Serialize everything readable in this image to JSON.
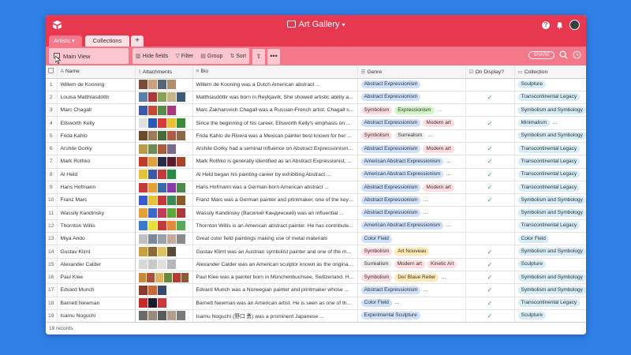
{
  "app": {
    "title": "Art Gallery",
    "accent_color": "#e8384f"
  },
  "tabs": {
    "artists": "Artists",
    "collections": "Collections",
    "add": "+"
  },
  "toolbar": {
    "view_label": "Main View",
    "hide_fields": "Hide fields",
    "filter": "Filter",
    "group": "Group",
    "sort": "Sort",
    "share": "SHARE",
    "more": "•••"
  },
  "columns": {
    "name": "Name",
    "attachments": "Attachments",
    "bio": "Bio",
    "genre": "Genre",
    "on_display": "On Display?",
    "collection": "Collection"
  },
  "rows": [
    {
      "num": "1",
      "name": "Willem de Kooning",
      "bio": "Willem de Kooning was a Dutch American abstract ...",
      "genre": [
        [
          "Abstract Expressionism",
          "blue"
        ]
      ],
      "display": false,
      "collection": [
        [
          "Sculpture",
          "teal"
        ]
      ],
      "thumbs": [
        "#7a4a3a",
        "#c9a07a",
        "#556677",
        "#b08f6f"
      ]
    },
    {
      "num": "2",
      "name": "Louisa Matthíasdóttir",
      "bio": "Matthíasdóttir was born in Reykjavík. She showed artistic ability a...",
      "genre": [
        [
          "Abstract Expressionism",
          "blue"
        ]
      ],
      "display": true,
      "collection": [
        [
          "Transcontinental Legacy",
          "teal"
        ]
      ],
      "thumbs": [
        "#5b7fa8",
        "#aa3a3a",
        "#8aa05a",
        "#c7b48a",
        "#3d5c7a"
      ]
    },
    {
      "num": "3",
      "name": "Marc Chagall",
      "bio": "Marc Zakharovich Chagall was a Russian-French artist. Chagall s...",
      "genre": [
        [
          "Symbolism",
          "red"
        ],
        [
          "Expressionism",
          "green"
        ],
        [
          "Fauvism",
          "cyan"
        ]
      ],
      "display": false,
      "collection": [
        [
          "Symbolism and Symbology",
          "teal"
        ]
      ],
      "thumbs": [
        "#3a5aa8",
        "#c44a3a",
        "#5a8a4a",
        "#a83a7a"
      ]
    },
    {
      "num": "4",
      "name": "Ellsworth Kelly",
      "bio": "Since the beginning of his career, Ellsworth Kelly's emphasis on ...",
      "genre": [
        [
          "Abstract Expressionism",
          "blue"
        ],
        [
          "Modern art",
          "red"
        ]
      ],
      "display": true,
      "collection": [
        [
          "Minimalism",
          "teal"
        ],
        [
          "Color Field",
          "teal"
        ]
      ],
      "thumbs": [
        "#e0e0e0",
        "#2a5ab8",
        "#d63a3a",
        "#e6c23a",
        "#3a8a3a"
      ]
    },
    {
      "num": "5",
      "name": "Frida Kahlo",
      "bio": "Frida Kahlo de Rivera was a Mexican painter best known for her ...",
      "genre": [
        [
          "Symbolism",
          "red"
        ],
        [
          "Surrealism",
          "gray"
        ],
        [
          "Magical Realism",
          "purple"
        ]
      ],
      "display": false,
      "collection": [
        [
          "Symbolism and Symbology",
          "teal"
        ]
      ],
      "thumbs": [
        "#6a4a2a",
        "#9a7a5a",
        "#4a6a3a",
        "#b05a4a",
        "#8a6a4a"
      ]
    },
    {
      "num": "6",
      "name": "Arshile Gorky",
      "bio": "Arshile Gorky had a seminal influence on Abstract Expressionism...",
      "genre": [
        [
          "Abstract Expressionism",
          "blue"
        ],
        [
          "Modern art",
          "red"
        ]
      ],
      "display": true,
      "collection": [
        [
          "Transcontinental Legacy",
          "teal"
        ]
      ],
      "thumbs": [
        "#b89a4a",
        "#6a8a5a",
        "#a85a3a",
        "#7a6a8a"
      ]
    },
    {
      "num": "7",
      "name": "Mark Rothko",
      "bio": "Mark Rothko is generally identified as an Abstract Expressionist, ...",
      "genre": [
        [
          "American Abstract Expressionism",
          "blue"
        ],
        [
          "Color F",
          "blue"
        ]
      ],
      "display": true,
      "collection": [
        [
          "Transcontinental Legacy",
          "teal"
        ]
      ],
      "thumbs": [
        "#c43a2a",
        "#e0a040",
        "#2a2a4a",
        "#5a1a2a",
        "#a8402a"
      ]
    },
    {
      "num": "8",
      "name": "Al Held",
      "bio": "Al Held began his painting career by exhibiting Abstract ...",
      "genre": [
        [
          "American Abstract Expressionism",
          "blue"
        ],
        [
          "Color F",
          "blue"
        ]
      ],
      "display": true,
      "collection": [
        [
          "Transcontinental Legacy",
          "teal"
        ]
      ],
      "thumbs": [
        "#e6c23a",
        "#3a5aa8",
        "#c43a3a",
        "#2a8a4a"
      ]
    },
    {
      "num": "9",
      "name": "Hans Hofmann",
      "bio": "Hans Hofmann was a German-born American abstract ...",
      "genre": [
        [
          "Abstract Expressionism",
          "blue"
        ],
        [
          "Modern art",
          "red"
        ]
      ],
      "display": true,
      "collection": [
        [
          "Transcontinental Legacy",
          "teal"
        ]
      ],
      "thumbs": [
        "#c43a3a",
        "#e6a03a",
        "#3a6aa8",
        "#8a3aa8",
        "#4a8a4a"
      ]
    },
    {
      "num": "10",
      "name": "Franz Marc",
      "bio": "Franz Marc was a German painter and printmaker, one of the key ...",
      "genre": [
        [
          "Abstract Expressionism",
          "blue"
        ],
        [
          "Der Blaue Reiter",
          "yellow"
        ]
      ],
      "display": true,
      "collection": [
        [
          "Symbolism and Symbology",
          "teal"
        ]
      ],
      "thumbs": [
        "#3a5ac8",
        "#e6c23a",
        "#c43a3a",
        "#3a8a5a",
        "#8a5a2a"
      ]
    },
    {
      "num": "11",
      "name": "Wassily Kandinsky",
      "bio": "Wassily Kandinsky (Василий Кандинский) was an influential ...",
      "genre": [
        [
          "Abstract Expressionism",
          "blue"
        ],
        [
          "Der Blaue Reiter",
          "yellow"
        ]
      ],
      "display": false,
      "collection": [
        [
          "Symbolism and Symbology",
          "teal"
        ]
      ],
      "thumbs": [
        "#e6a03a",
        "#3a6ac8",
        "#c43a5a",
        "#5aa83a",
        "#a83a3a"
      ]
    },
    {
      "num": "12",
      "name": "Thornton Willis",
      "bio": "Thornton Willis is an American abstract painter. He has contribute...",
      "genre": [
        [
          "American Abstract Expressionism",
          "blue"
        ],
        [
          "Color F",
          "blue"
        ]
      ],
      "display": false,
      "collection": [
        [
          "Transcontinental Legacy",
          "teal"
        ]
      ],
      "thumbs": [
        "#3a7ac8",
        "#e6e03a",
        "#c43a3a",
        "#e08a3a",
        "#5aa85a"
      ]
    },
    {
      "num": "13",
      "name": "Miya Ando",
      "bio": "Great color field paintings making use of metal materials",
      "genre": [
        [
          "Color Field",
          "blue"
        ]
      ],
      "display": false,
      "collection": [
        [
          "Color Field",
          "teal"
        ]
      ],
      "thumbs": [
        "#bfbfbf",
        "#7a8a9a",
        "#9aa0a8",
        "#c8a8a0",
        "#8a8a8a"
      ]
    },
    {
      "num": "14",
      "name": "Gustav Klimt",
      "bio": "Gustav Klimt was an Austrian symbolist painter and one of the m...",
      "genre": [
        [
          "Symbolism",
          "red"
        ],
        [
          "Art Nouveau",
          "yellow"
        ]
      ],
      "display": true,
      "collection": [
        [
          "Symbolism and Symbology",
          "teal"
        ]
      ],
      "thumbs": [
        "#c8a040",
        "#8a6a3a",
        "#e0c060",
        "#5a4a3a"
      ]
    },
    {
      "num": "15",
      "name": "Alexander Calder",
      "bio": "Alexander Calder was an American sculptor known as the originat...",
      "genre": [
        [
          "Surrealism",
          "gray"
        ],
        [
          "Modern art",
          "red"
        ],
        [
          "Kinetic Art",
          "red"
        ]
      ],
      "display": true,
      "collection": [
        [
          "Sculpture",
          "teal"
        ]
      ],
      "thumbs": [
        "#d8d8d8",
        "#c8c8c8",
        "#e0e0e0",
        "#b8b8b8"
      ]
    },
    {
      "num": "16",
      "name": "Paul Klee",
      "bio": "Paul Klee was a painter born in Münchenbuchsee, Switzerland. H...",
      "genre": [
        [
          "Symbolism",
          "red"
        ],
        [
          "Der Blaue Reiter",
          "yellow"
        ],
        [
          "Bauhaus",
          "purple"
        ]
      ],
      "display": true,
      "collection": [
        [
          "Symbolism and Symbology",
          "teal"
        ]
      ],
      "thumbs": [
        "#c88a3a",
        "#a8503a",
        "#e0b060",
        "#6a8a3a",
        "#b83a2a",
        "#8a5a3a"
      ]
    },
    {
      "num": "17",
      "name": "Edvard Munch",
      "bio": "Edvard Munch was a Norwegian painter and printmaker whose ...",
      "genre": [
        [
          "Abstract Expressionism",
          "blue"
        ],
        [
          "Modern art",
          "red"
        ],
        [
          "Sy",
          "gray"
        ]
      ],
      "display": true,
      "collection": [
        [
          "Symbolism and Symbology",
          "teal"
        ]
      ],
      "thumbs": [
        "#8a3a2a",
        "#c86a3a",
        "#3a4a6a"
      ]
    },
    {
      "num": "18",
      "name": "Barnett Newman",
      "bio": "Barnett Newman was an American artist. He is seen as one of the ...",
      "genre": [
        [
          "Color Field",
          "blue"
        ],
        [
          "American Abstract Expressio",
          "blue"
        ]
      ],
      "display": true,
      "collection": [
        [
          "Transcontinental Legacy",
          "teal"
        ]
      ],
      "thumbs": [
        "#c42a2a",
        "#1a1a2a",
        "#c83a3a"
      ]
    },
    {
      "num": "19",
      "name": "Isamu Noguchi",
      "bio": "Isamu Noguchi (野口 勇) was a prominent Japanese ...",
      "genre": [
        [
          "Experimental Sculpture",
          "blue"
        ]
      ],
      "display": true,
      "collection": [
        [
          "Sculpture",
          "teal"
        ]
      ],
      "thumbs": [
        "#6a6a6a",
        "#9a8a7a",
        "#5a5a5a",
        "#b0a090",
        "#7a7a7a"
      ]
    }
  ],
  "footer": {
    "records": "19 records"
  }
}
